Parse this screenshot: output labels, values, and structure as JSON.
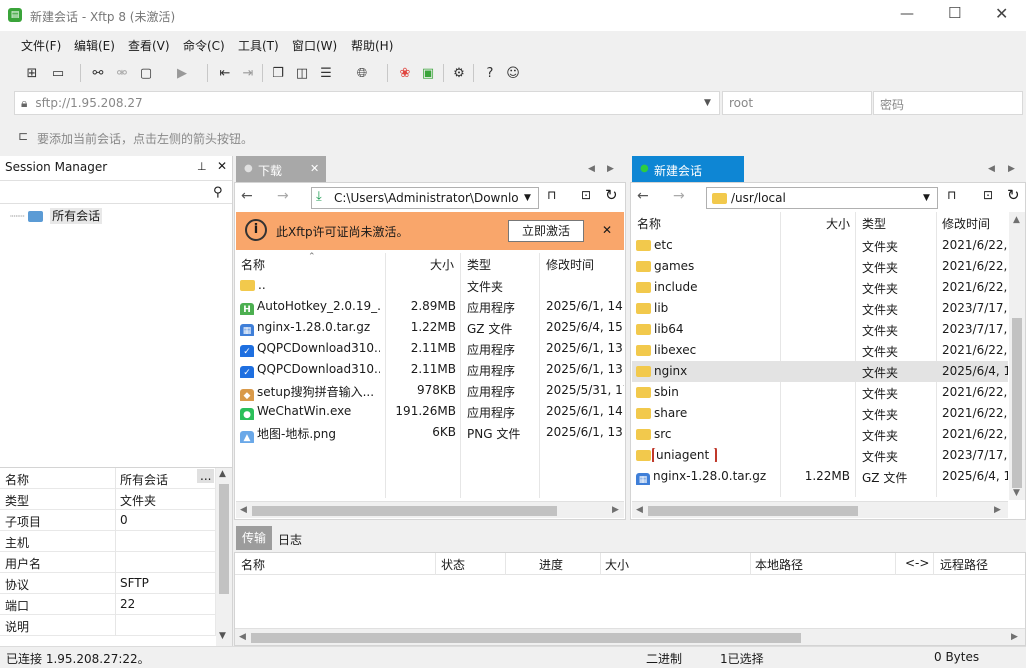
{
  "window": {
    "title": "新建会话 - Xftp 8 (未激活)"
  },
  "menu": [
    "文件(F)",
    "编辑(E)",
    "查看(V)",
    "命令(C)",
    "工具(T)",
    "窗口(W)",
    "帮助(H)"
  ],
  "address": {
    "url": "sftp://1.95.208.27",
    "user_placeholder": "root",
    "password_placeholder": "密码"
  },
  "hint": "要添加当前会话，点击左侧的箭头按钮。",
  "session_manager": {
    "title": "Session Manager",
    "tree_root": "所有会话",
    "properties": [
      {
        "name": "名称",
        "value": "所有会话"
      },
      {
        "name": "类型",
        "value": "文件夹"
      },
      {
        "name": "子项目",
        "value": "0"
      },
      {
        "name": "主机",
        "value": ""
      },
      {
        "name": "用户名",
        "value": ""
      },
      {
        "name": "协议",
        "value": "SFTP"
      },
      {
        "name": "端口",
        "value": "22"
      },
      {
        "name": "说明",
        "value": ""
      }
    ]
  },
  "left_pane": {
    "tab": "下载",
    "path": "C:\\Users\\Administrator\\Downlo",
    "license_banner": {
      "text": "此Xftp许可证尚未激活。",
      "button": "立即激活"
    },
    "columns": {
      "name": "名称",
      "size": "大小",
      "type": "类型",
      "mtime": "修改时间"
    },
    "files": [
      {
        "name": "..",
        "size": "",
        "type": "文件夹",
        "mtime": "",
        "icon": "folder-icon"
      },
      {
        "name": "AutoHotkey_2.0.19_...",
        "size": "2.89MB",
        "type": "应用程序",
        "mtime": "2025/6/1, 14:5",
        "icon": "autohotkey-icon"
      },
      {
        "name": "nginx-1.28.0.tar.gz",
        "size": "1.22MB",
        "type": "GZ 文件",
        "mtime": "2025/6/4, 15:",
        "icon": "archive-icon"
      },
      {
        "name": "QQPCDownload310...",
        "size": "2.11MB",
        "type": "应用程序",
        "mtime": "2025/6/1, 13:2",
        "icon": "qqpc-icon"
      },
      {
        "name": "QQPCDownload310...",
        "size": "2.11MB",
        "type": "应用程序",
        "mtime": "2025/6/1, 13:2",
        "icon": "qqpc-icon"
      },
      {
        "name": "setup搜狗拼音输入...",
        "size": "978KB",
        "type": "应用程序",
        "mtime": "2025/5/31, 17",
        "icon": "installer-icon"
      },
      {
        "name": "WeChatWin.exe",
        "size": "191.26MB",
        "type": "应用程序",
        "mtime": "2025/6/1, 14:",
        "icon": "wechat-icon"
      },
      {
        "name": "地图-地标.png",
        "size": "6KB",
        "type": "PNG 文件",
        "mtime": "2025/6/1, 13:2",
        "icon": "image-icon"
      }
    ]
  },
  "right_pane": {
    "tab": "新建会话",
    "path": "/usr/local",
    "columns": {
      "name": "名称",
      "size": "大小",
      "type": "类型",
      "mtime": "修改时间"
    },
    "files": [
      {
        "name": "etc",
        "size": "",
        "type": "文件夹",
        "mtime": "2021/6/22,"
      },
      {
        "name": "games",
        "size": "",
        "type": "文件夹",
        "mtime": "2021/6/22,"
      },
      {
        "name": "include",
        "size": "",
        "type": "文件夹",
        "mtime": "2021/6/22,"
      },
      {
        "name": "lib",
        "size": "",
        "type": "文件夹",
        "mtime": "2023/7/17,"
      },
      {
        "name": "lib64",
        "size": "",
        "type": "文件夹",
        "mtime": "2023/7/17,"
      },
      {
        "name": "libexec",
        "size": "",
        "type": "文件夹",
        "mtime": "2021/6/22,"
      },
      {
        "name": "nginx",
        "size": "",
        "type": "文件夹",
        "mtime": "2025/6/4, 1"
      },
      {
        "name": "sbin",
        "size": "",
        "type": "文件夹",
        "mtime": "2021/6/22,"
      },
      {
        "name": "share",
        "size": "",
        "type": "文件夹",
        "mtime": "2021/6/22,"
      },
      {
        "name": "src",
        "size": "",
        "type": "文件夹",
        "mtime": "2021/6/22,"
      },
      {
        "name": "uniagent",
        "size": "",
        "type": "文件夹",
        "mtime": "2023/7/17,"
      },
      {
        "name": "nginx-1.28.0.tar.gz",
        "size": "1.22MB",
        "type": "GZ 文件",
        "mtime": "2025/6/4, 1"
      }
    ]
  },
  "transfer": {
    "tabs": [
      "传输",
      "日志"
    ],
    "columns": {
      "name": "名称",
      "status": "状态",
      "progress": "进度",
      "size": "大小",
      "local": "本地路径",
      "arrow": "<->",
      "remote": "远程路径"
    }
  },
  "status": {
    "left": "已连接 1.95.208.27:22。",
    "mode": "二进制",
    "selection": "1已选择",
    "bytes": "0 Bytes"
  },
  "colors": {
    "accent": "#0e86d4",
    "banner": "#f9a66b",
    "highlight": "#c0392b"
  }
}
